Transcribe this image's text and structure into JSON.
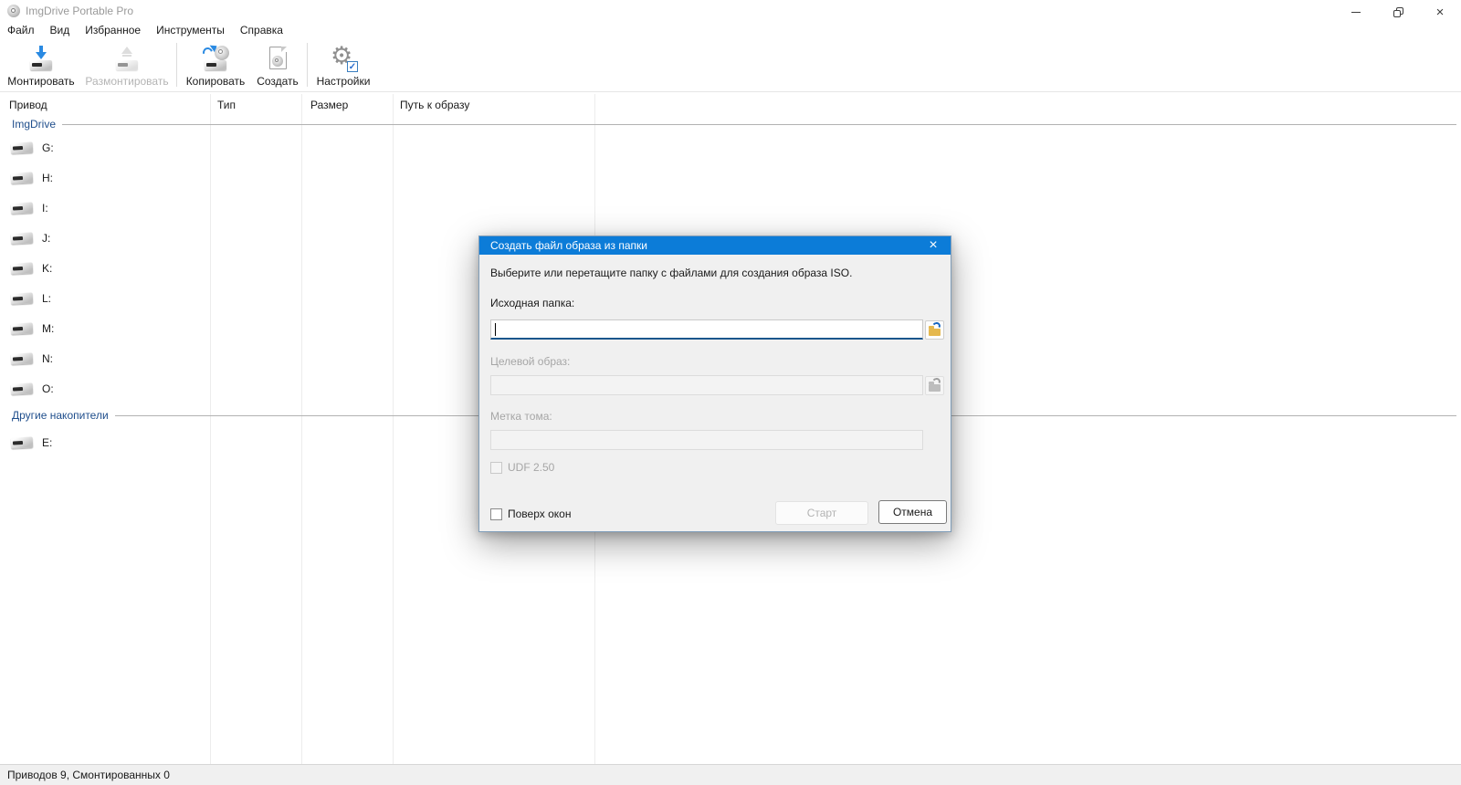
{
  "window": {
    "title": "ImgDrive Portable Pro"
  },
  "menu": {
    "items": [
      {
        "label": "Файл"
      },
      {
        "label": "Вид"
      },
      {
        "label": "Избранное"
      },
      {
        "label": "Инструменты"
      },
      {
        "label": "Справка"
      }
    ]
  },
  "toolbar": {
    "buttons": [
      {
        "label": "Монтировать",
        "enabled": true,
        "icon": "mount-drive-icon"
      },
      {
        "label": "Размонтировать",
        "enabled": false,
        "icon": "eject-drive-icon"
      },
      {
        "label": "Копировать",
        "enabled": true,
        "icon": "copy-disc-icon"
      },
      {
        "label": "Создать",
        "enabled": true,
        "icon": "create-image-icon"
      },
      {
        "label": "Настройки",
        "enabled": true,
        "icon": "settings-gear-icon"
      }
    ]
  },
  "drive_list": {
    "columns": [
      {
        "label": "Привод"
      },
      {
        "label": "Тип"
      },
      {
        "label": "Размер"
      },
      {
        "label": "Путь к образу"
      }
    ],
    "groups": [
      {
        "label": "ImgDrive",
        "drives": [
          {
            "letter": "G:"
          },
          {
            "letter": "H:"
          },
          {
            "letter": "I:"
          },
          {
            "letter": "J:"
          },
          {
            "letter": "K:"
          },
          {
            "letter": "L:"
          },
          {
            "letter": "M:"
          },
          {
            "letter": "N:"
          },
          {
            "letter": "O:"
          }
        ]
      },
      {
        "label": "Другие накопители",
        "drives": [
          {
            "letter": "E:"
          }
        ]
      }
    ]
  },
  "status_bar": {
    "text": "Приводов 9, Смонтированных 0"
  },
  "dialog": {
    "title": "Создать файл образа из папки",
    "instruction": "Выберите или перетащите папку с файлами для создания образа ISO.",
    "fields": [
      {
        "label": "Исходная папка:",
        "value": "",
        "enabled": true
      },
      {
        "label": "Целевой образ:",
        "value": "",
        "enabled": false
      },
      {
        "label": "Метка тома:",
        "value": "",
        "enabled": false
      }
    ],
    "checkboxes": [
      {
        "label": "UDF 2.50",
        "checked": false,
        "enabled": false
      },
      {
        "label": "Поверх окон",
        "checked": false,
        "enabled": true
      }
    ],
    "buttons": [
      {
        "label": "Старт",
        "enabled": false
      },
      {
        "label": "Отмена",
        "enabled": true
      }
    ]
  },
  "icons": {
    "settings_glyph": "⚙",
    "gear_check_glyph": "✓",
    "window_close_glyph": "×",
    "dialog_close_glyph": "×"
  },
  "colors": {
    "dialog_titlebar": "#0c7cd8",
    "focused_underline": "#19568c",
    "group_header_text": "#1f4e8c",
    "toolbar_accent_blue": "#2a8ae2"
  }
}
